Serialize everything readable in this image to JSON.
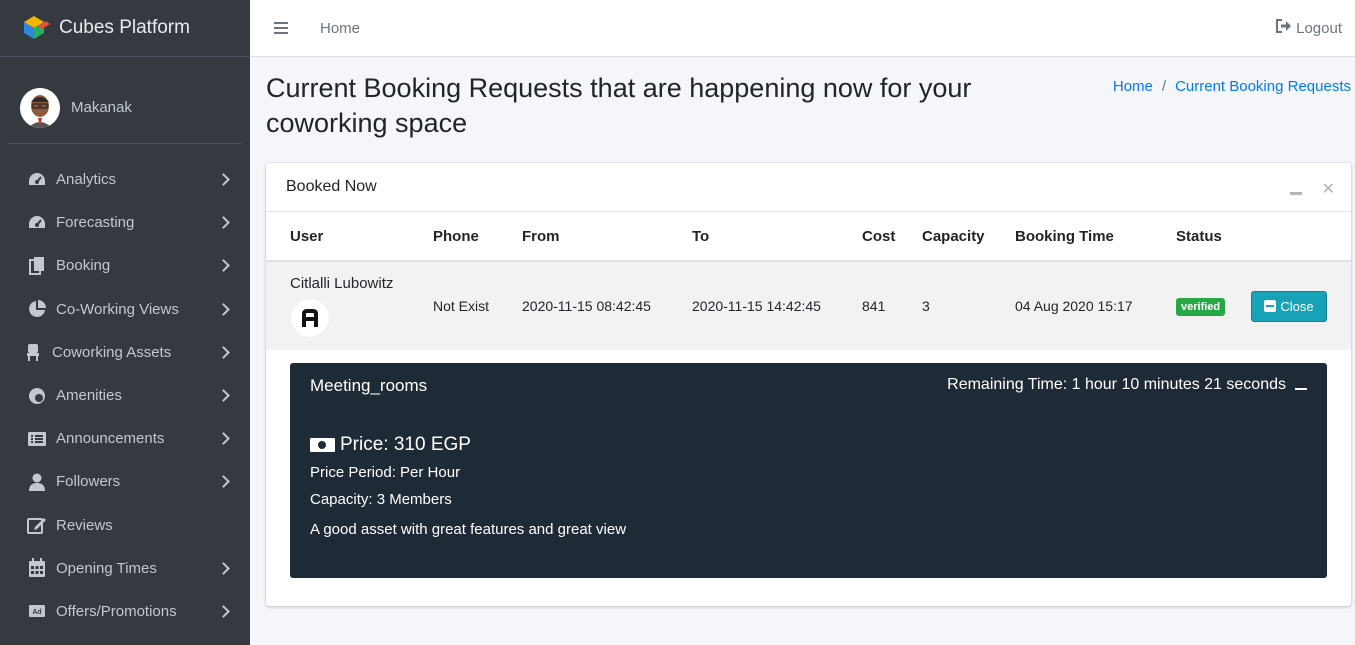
{
  "brand": {
    "title": "Cubes Platform"
  },
  "user": {
    "name": "Makanak"
  },
  "sidebar": {
    "items": [
      {
        "label": "Analytics",
        "icon": "tachometer-icon",
        "has_chevron": true
      },
      {
        "label": "Forecasting",
        "icon": "tachometer-icon",
        "has_chevron": true
      },
      {
        "label": "Booking",
        "icon": "copy-icon",
        "has_chevron": true
      },
      {
        "label": "Co-Working Views",
        "icon": "pie-chart-icon",
        "has_chevron": true
      },
      {
        "label": "Coworking Assets",
        "icon": "chair-icon",
        "has_chevron": true
      },
      {
        "label": "Amenities",
        "icon": "amenities-icon",
        "has_chevron": true
      },
      {
        "label": "Announcements",
        "icon": "list-card-icon",
        "has_chevron": true
      },
      {
        "label": "Followers",
        "icon": "user-icon",
        "has_chevron": true
      },
      {
        "label": "Reviews",
        "icon": "edit-icon",
        "has_chevron": false
      },
      {
        "label": "Opening Times",
        "icon": "calendar-icon",
        "has_chevron": true
      },
      {
        "label": "Offers/Promotions",
        "icon": "ad-icon",
        "has_chevron": true
      }
    ]
  },
  "topbar": {
    "home": "Home",
    "logout": "Logout"
  },
  "page": {
    "title": "Current Booking Requests that are happening now for your coworking space"
  },
  "breadcrumb": {
    "home": "Home",
    "sep": "/",
    "current": "Current Booking Requests"
  },
  "card": {
    "title": "Booked Now",
    "columns": [
      "User",
      "Phone",
      "From",
      "To",
      "Cost",
      "Capacity",
      "Booking Time",
      "Status"
    ],
    "row": {
      "user": "Citlalli Lubowitz",
      "phone": "Not Exist",
      "from": "2020-11-15 08:42:45",
      "to": "2020-11-15 14:42:45",
      "cost": "841",
      "capacity": "3",
      "booking_time": "04 Aug 2020 15:17",
      "status": "verified",
      "action": "Close"
    },
    "detail": {
      "name": "Meeting_rooms",
      "remaining": "Remaining Time: 1 hour 10 minutes 21 seconds",
      "price": "Price: 310 EGP",
      "price_period": "Price Period: Per Hour",
      "capacity": "Capacity: 3 Members",
      "description": "A good asset with great features and great view"
    }
  },
  "colors": {
    "sidebar_bg": "#343a40",
    "accent": "#007bff",
    "info": "#17a2b8",
    "success": "#28a745",
    "detail_bg": "#1f2a37"
  }
}
